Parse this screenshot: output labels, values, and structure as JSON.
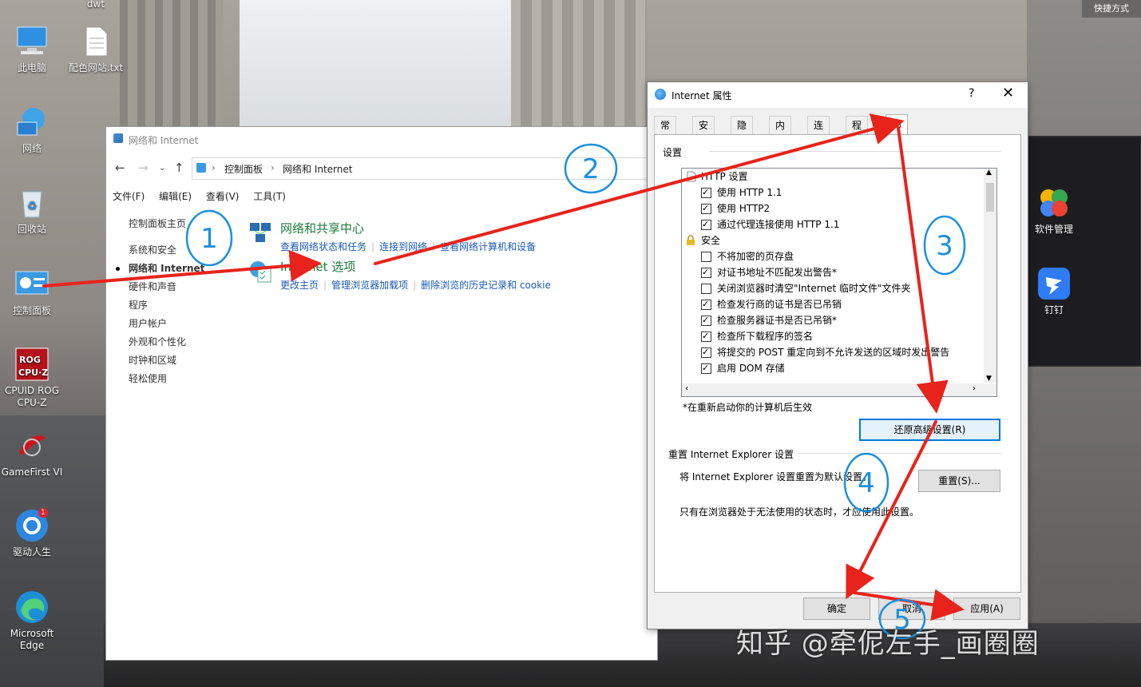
{
  "desktop": {
    "quick_access": "快捷方式",
    "top_label": "dwt",
    "icons": [
      {
        "label": "此电脑",
        "icon": "computer-icon"
      },
      {
        "label": "配色网站.txt",
        "icon": "text-file-icon"
      },
      {
        "label": "网络",
        "icon": "network-icon"
      },
      {
        "label": "回收站",
        "icon": "recycle-bin-icon"
      },
      {
        "label": "控制面板",
        "icon": "control-panel-icon"
      },
      {
        "label": "CPUID ROG CPU-Z",
        "icon": "cpuz-icon"
      },
      {
        "label": "GameFirst VI",
        "icon": "gamefirst-icon"
      },
      {
        "label": "驱动人生",
        "icon": "driver-icon",
        "badge": "1"
      },
      {
        "label": "Microsoft Edge",
        "icon": "edge-icon"
      },
      {
        "label": "软件管理",
        "icon": "software-manager-icon"
      },
      {
        "label": "钉钉",
        "icon": "dingtalk-icon"
      }
    ]
  },
  "control_panel": {
    "title": "网络和 Internet",
    "breadcrumb": [
      "控制面板",
      "网络和 Internet"
    ],
    "menu": [
      "文件(F)",
      "编辑(E)",
      "查看(V)",
      "工具(T)"
    ],
    "sidebar": {
      "home": "控制面板主页",
      "items": [
        "系统和安全",
        "网络和 Internet",
        "硬件和声音",
        "程序",
        "用户帐户",
        "外观和个性化",
        "时钟和区域",
        "轻松使用"
      ]
    },
    "categories": [
      {
        "title": "网络和共享中心",
        "links": [
          "查看网络状态和任务",
          "连接到网络",
          "查看网络计算机和设备"
        ]
      },
      {
        "title": "Internet 选项",
        "links": [
          "更改主页",
          "管理浏览器加载项",
          "删除浏览的历史记录和 cookie"
        ]
      }
    ]
  },
  "dialog": {
    "title": "Internet 属性",
    "help": "?",
    "close": "✕",
    "tabs": [
      "常规",
      "安全",
      "隐私",
      "内容",
      "连接",
      "程序",
      "高级"
    ],
    "active_tab": "高级",
    "settings_label": "设置",
    "tree_rows": [
      {
        "text": "HTTP 设置",
        "type": "header"
      },
      {
        "text": "使用 HTTP 1.1",
        "checked": true
      },
      {
        "text": "使用 HTTP2",
        "checked": true
      },
      {
        "text": "通过代理连接使用 HTTP 1.1",
        "checked": true
      },
      {
        "text": "安全",
        "type": "header"
      },
      {
        "text": "不将加密的页存盘",
        "checked": false
      },
      {
        "text": "对证书地址不匹配发出警告*",
        "checked": true
      },
      {
        "text": "关闭浏览器时清空\"Internet 临时文件\"文件夹",
        "checked": false
      },
      {
        "text": "检查发行商的证书是否已吊销",
        "checked": true
      },
      {
        "text": "检查服务器证书是否已吊销*",
        "checked": true
      },
      {
        "text": "检查所下载程序的签名",
        "checked": true
      },
      {
        "text": "将提交的 POST 重定向到不允许发送的区域时发出警告",
        "checked": true
      },
      {
        "text": "启用 DOM 存储",
        "checked": true
      }
    ],
    "restart_note": "*在重新启动你的计算机后生效",
    "restore_button": "还原高级设置(R)",
    "reset_group_label": "重置 Internet Explorer 设置",
    "reset_desc": "将 Internet Explorer 设置重置为默认设置。",
    "reset_button": "重置(S)...",
    "reset_note": "只有在浏览器处于无法使用的状态时，才应使用此设置。",
    "ok": "确定",
    "cancel": "取消",
    "apply": "应用(A)"
  },
  "annotations": {
    "numbers": [
      "1",
      "2",
      "3",
      "4",
      "5"
    ],
    "arrow_color": "#e8231b",
    "number_color": "#1b8fe0"
  },
  "watermark": "知乎 @牵伲左手_画圈圈"
}
